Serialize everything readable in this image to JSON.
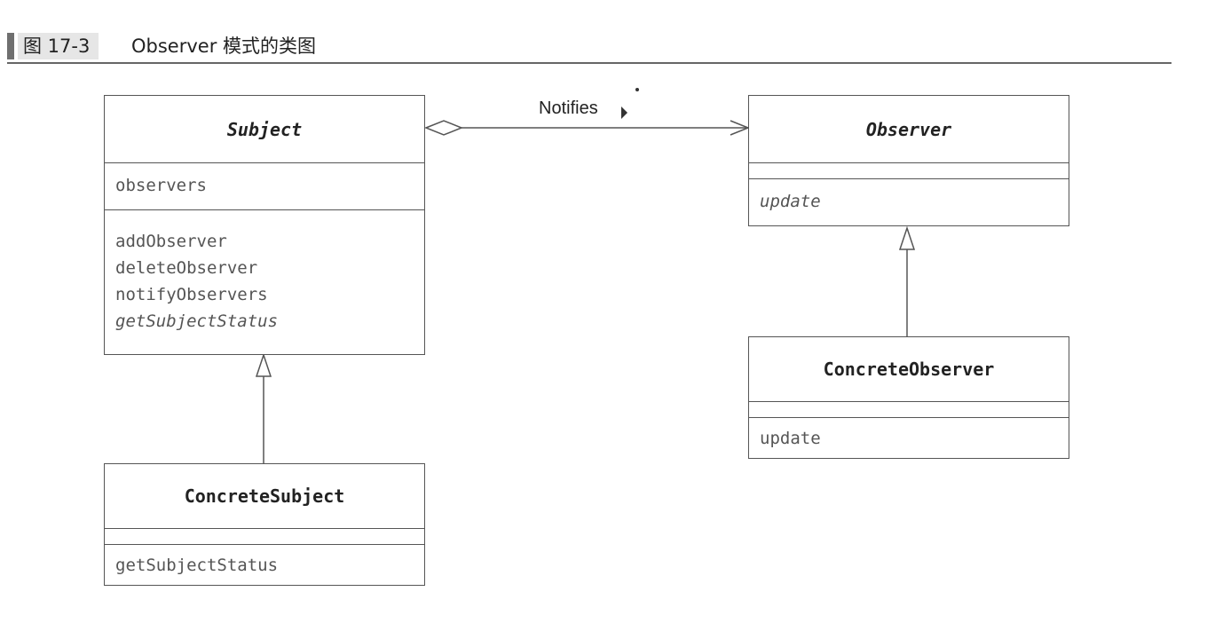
{
  "figure": {
    "number": "图 17-3",
    "title": "Observer 模式的类图"
  },
  "classes": {
    "subject": {
      "name": "Subject",
      "fields": [
        "observers"
      ],
      "methods": [
        "addObserver",
        "deleteObserver",
        "notifyObservers",
        "getSubjectStatus"
      ]
    },
    "concrete_subject": {
      "name": "ConcreteSubject",
      "methods": [
        "getSubjectStatus"
      ]
    },
    "observer": {
      "name": "Observer",
      "methods": [
        "update"
      ]
    },
    "concrete_observer": {
      "name": "ConcreteObserver",
      "methods": [
        "update"
      ]
    }
  },
  "association": {
    "label": "Notifies"
  }
}
